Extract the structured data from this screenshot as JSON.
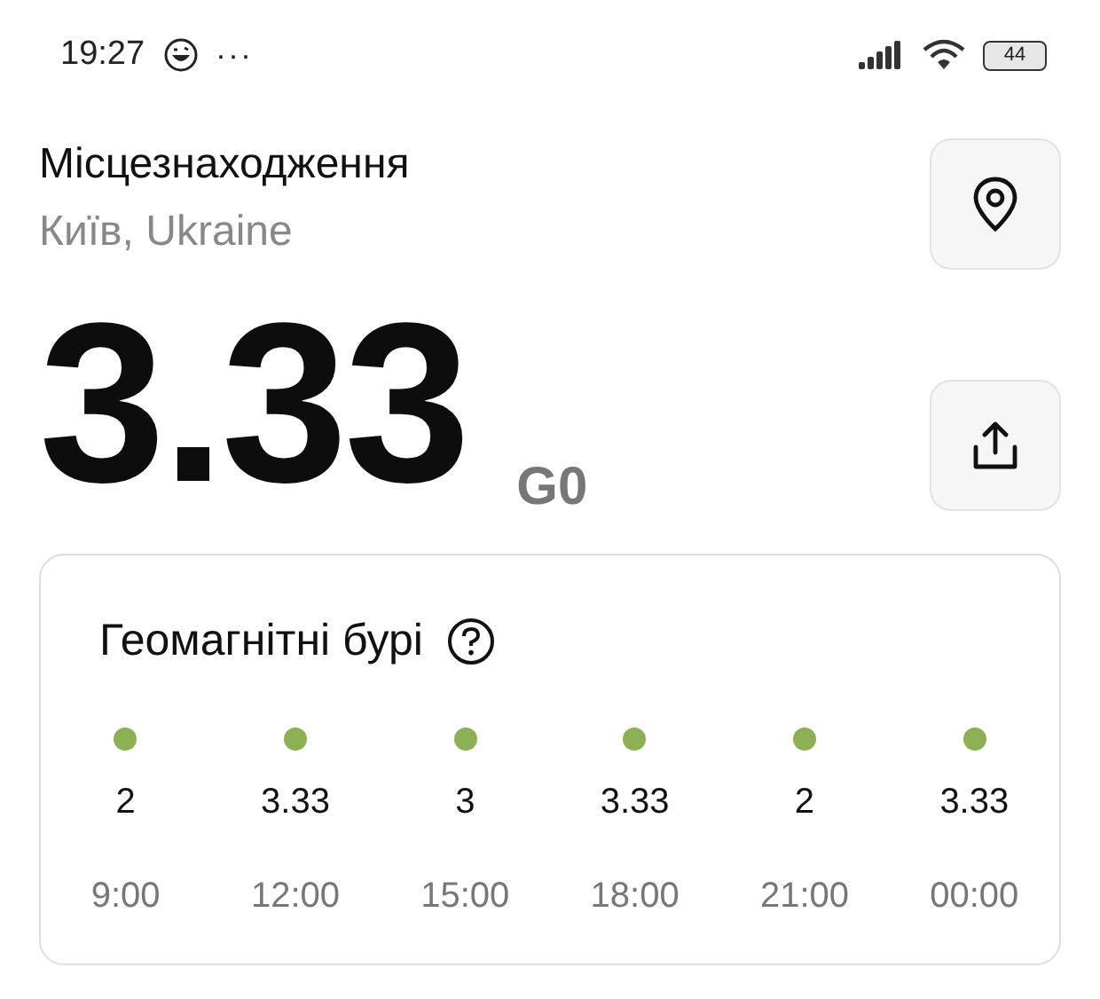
{
  "status_bar": {
    "time": "19:27",
    "more": "···",
    "battery": "44"
  },
  "location": {
    "label": "Місцезнаходження",
    "value": "Київ, Ukraine"
  },
  "index": {
    "value": "3.33",
    "grade": "G0"
  },
  "storm_card": {
    "title": "Геомагнітні бурі",
    "forecast": [
      {
        "value": "2",
        "time": "9:00"
      },
      {
        "value": "3.33",
        "time": "12:00"
      },
      {
        "value": "3",
        "time": "15:00"
      },
      {
        "value": "3.33",
        "time": "18:00"
      },
      {
        "value": "2",
        "time": "21:00"
      },
      {
        "value": "3.33",
        "time": "00:00"
      }
    ]
  }
}
